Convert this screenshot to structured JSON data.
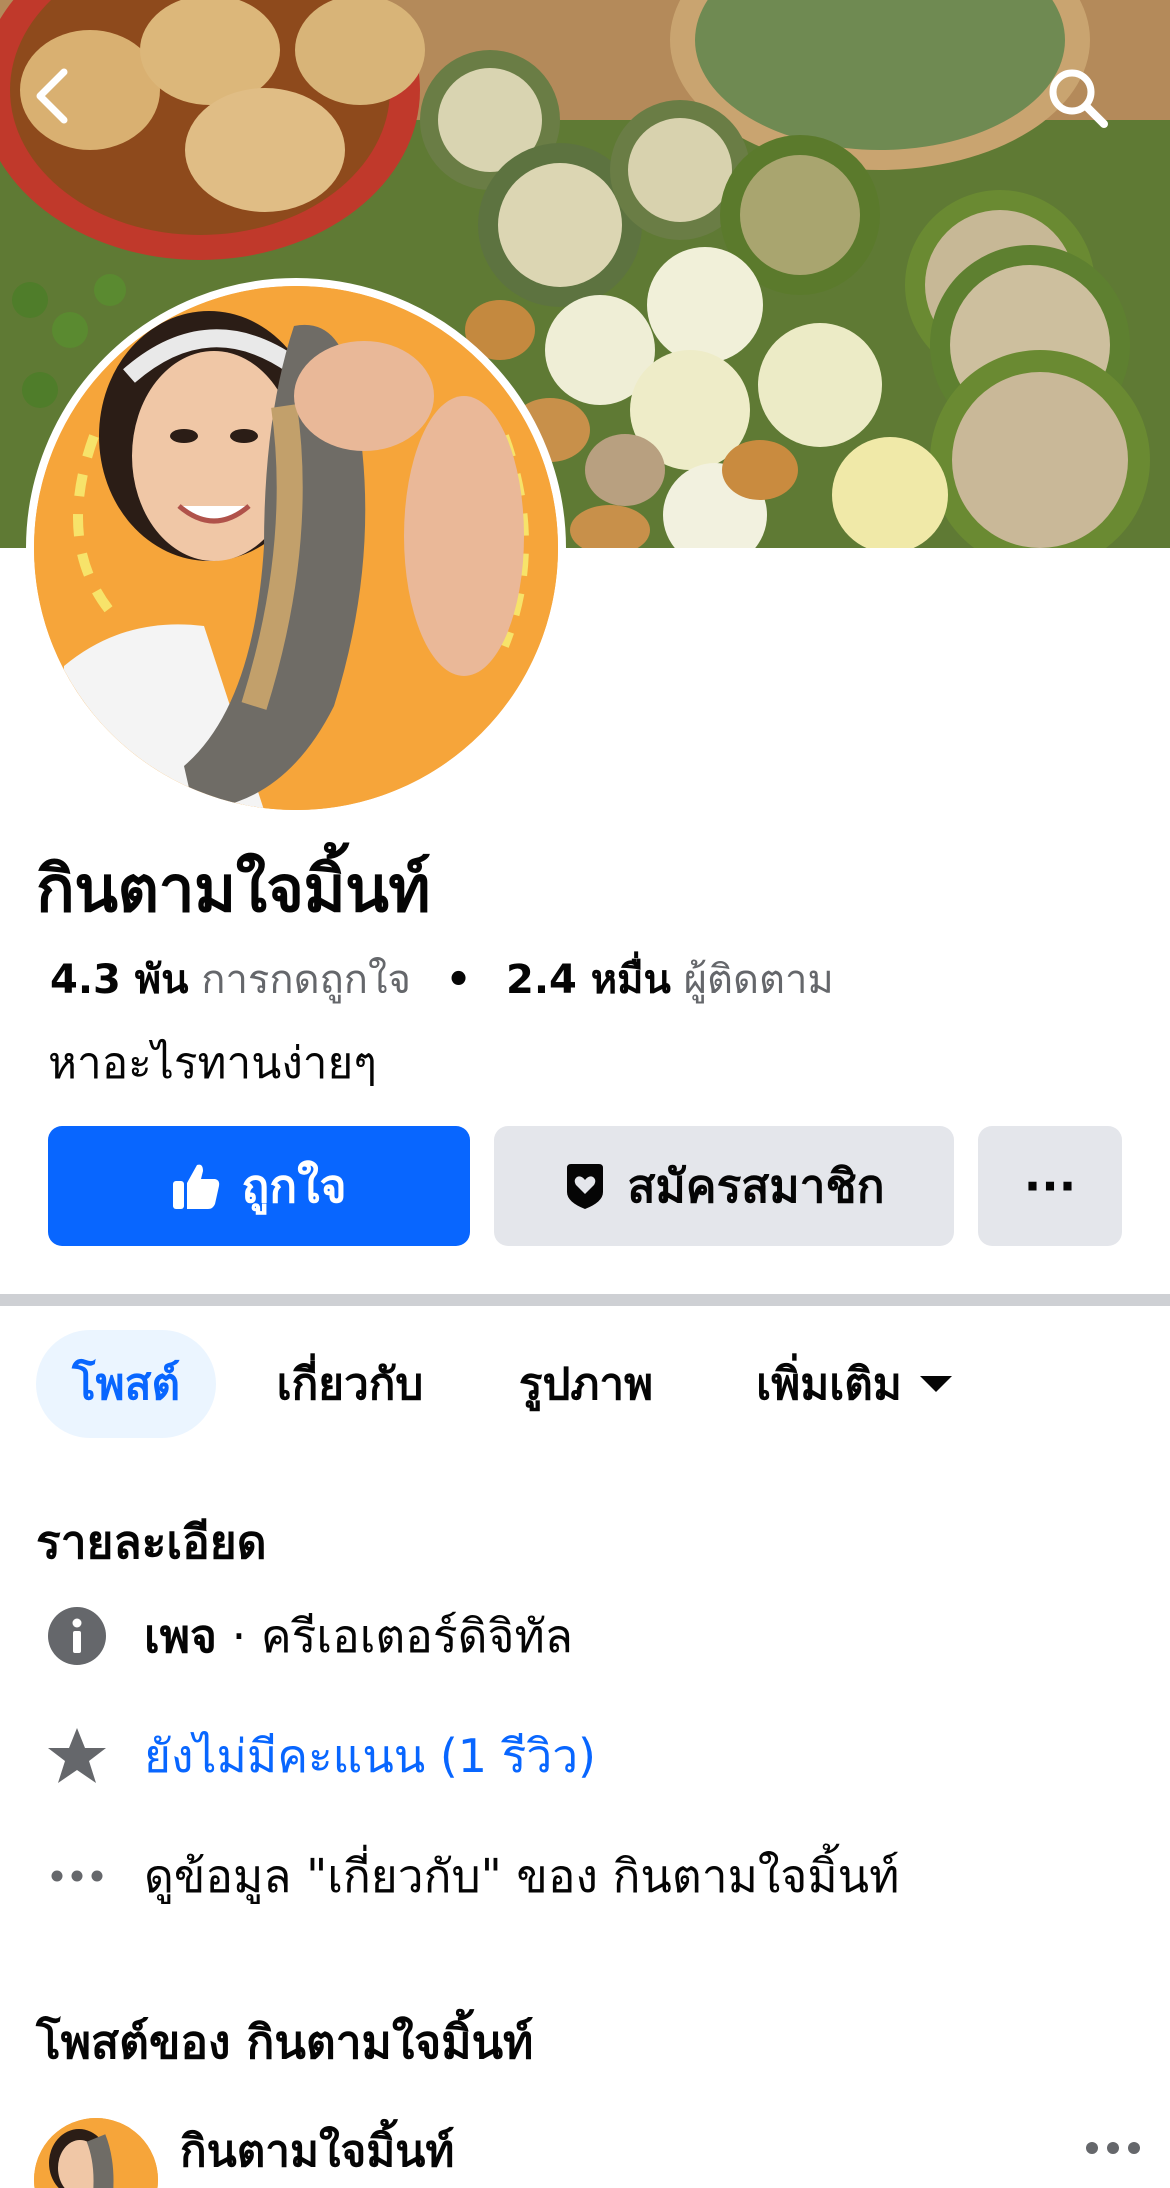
{
  "header": {
    "back_icon": "chevron-left-icon",
    "search_icon": "search-icon"
  },
  "profile": {
    "name": "กินตามใจมิ้นท์",
    "likes_count": "4.3 พัน",
    "likes_label": "การกดถูกใจ",
    "separator": "•",
    "followers_count": "2.4 หมื่น",
    "followers_label": "ผู้ติดตาม",
    "bio": "หาอะไรทานง่ายๆ"
  },
  "actions": {
    "like_label": "ถูกใจ",
    "like_icon": "thumbs-up-icon",
    "subscribe_label": "สมัครสมาชิก",
    "subscribe_icon": "badge-heart-icon",
    "more_label": "···",
    "like_color": "#0866ff"
  },
  "tabs": [
    {
      "label": "โพสต์",
      "active": true
    },
    {
      "label": "เกี่ยวกับ",
      "active": false
    },
    {
      "label": "รูปภาพ",
      "active": false
    },
    {
      "label": "เพิ่มเติม",
      "active": false
    }
  ],
  "details": {
    "title": "รายละเอียด",
    "info_type": "เพจ",
    "info_separator": " · ",
    "info_category": "ครีเอเตอร์ดิจิทัล",
    "rating_text": "ยังไม่มีคะแนน (1 รีวิว)",
    "about_link_text": "ดูข้อมูล \"เกี่ยวกับ\" ของ กินตามใจมิ้นท์"
  },
  "posts": {
    "title": "โพสต์ของ กินตามใจมิ้นท์",
    "first_author": "กินตามใจมิ้นท์",
    "menu_label": "···"
  }
}
